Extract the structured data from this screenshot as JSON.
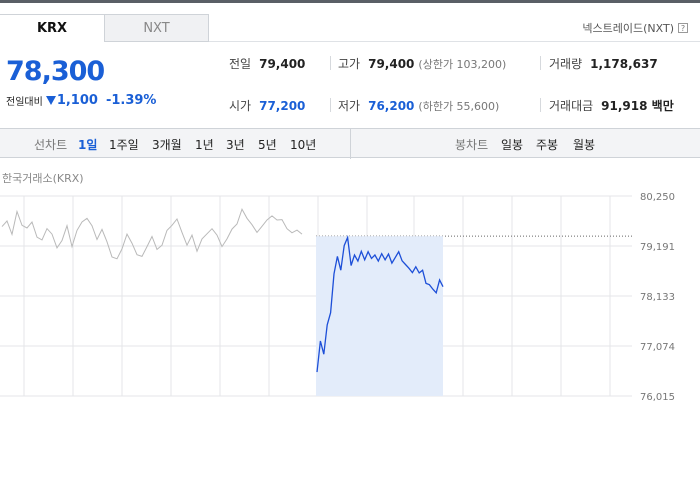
{
  "market_tabs": [
    "KRX",
    "NXT"
  ],
  "nxt_trade_label": "넥스트레이드(NXT)",
  "help_glyph": "?",
  "price": {
    "current": "78,300",
    "change_label": "전일대비",
    "change": "1,100",
    "change_rate": "-1.39%",
    "direction": "down"
  },
  "quote": {
    "prev_close": {
      "label": "전일",
      "value": "79,400"
    },
    "high": {
      "label": "고가",
      "value": "79,400",
      "sub": "(상한가 103,200)"
    },
    "volume": {
      "label": "거래량",
      "value": "1,178,637"
    },
    "open": {
      "label": "시가",
      "value": "77,200"
    },
    "low": {
      "label": "저가",
      "value": "76,200",
      "sub": "(하한가 55,600)"
    },
    "amount": {
      "label": "거래대금",
      "value": "91,918 백만"
    }
  },
  "toolbar": {
    "line_chart_label": "선차트",
    "periods": [
      "1일",
      "1주일",
      "3개월",
      "1년",
      "3년",
      "5년",
      "10년"
    ],
    "active_period": "1일",
    "candle_chart_label": "봉차트",
    "candle_periods": [
      "일봉",
      "주봉",
      "월봉"
    ]
  },
  "chart_title": "한국거래소(KRX)",
  "chart_data": {
    "type": "line",
    "y_ticks": [
      "80,250",
      "79,191",
      "78,133",
      "77,074",
      "76,015"
    ],
    "ylim": [
      76015,
      80250
    ],
    "prev_close": 79400,
    "prev_day_series": [
      79560,
      79720,
      79480,
      79900,
      79650,
      79530,
      79700,
      79420,
      79300,
      79580,
      79400,
      79150,
      79350,
      79600,
      79200,
      79480,
      79700,
      79820,
      79600,
      79350,
      79500,
      79280,
      79000,
      78900,
      79150,
      79400,
      79250,
      79050,
      78950,
      79200,
      79350,
      79120,
      79250,
      79500,
      79650,
      79720,
      79480,
      79250,
      79400,
      79100,
      79300,
      79450,
      79600,
      79400,
      79200,
      79300,
      79550,
      79700,
      79950,
      79800,
      79600,
      79480,
      79650,
      79720,
      79850,
      79700,
      79750,
      79600,
      79450,
      79550,
      79400
    ],
    "today_series": [
      76500,
      77200,
      76900,
      77500,
      77800,
      78600,
      78950,
      78700,
      79200,
      79350,
      78800,
      79000,
      78850,
      79100,
      78900,
      79050,
      78950,
      79000,
      78850,
      79050,
      78900,
      79000,
      78850,
      78950,
      79050,
      78900,
      78800,
      78700,
      78650,
      78750,
      78600,
      78700,
      78400,
      78350,
      78300,
      78200,
      78450,
      78350
    ]
  },
  "colors": {
    "accent_blue": "#1a5fd6",
    "today_line": "#1d4fd8",
    "today_fill": "#e3ecfa",
    "prev_line": "#b9b9b9",
    "grid": "#e4e6e9"
  }
}
